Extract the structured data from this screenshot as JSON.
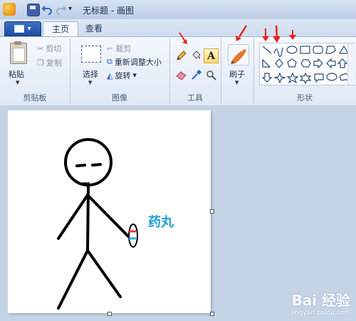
{
  "window": {
    "title": "无标题 - 画图"
  },
  "tabs": {
    "file_icon": "file-menu-icon",
    "home": "主页",
    "view": "查看"
  },
  "clipboard": {
    "paste": "粘贴",
    "cut": "剪切",
    "copy": "复制",
    "group_label": "剪贴板"
  },
  "image": {
    "select": "选择",
    "crop": "裁剪",
    "resize": "重新调整大小",
    "rotate": "旋转",
    "group_label": "图像"
  },
  "tools": {
    "group_label": "工具",
    "icons": [
      "pencil-icon",
      "fill-icon",
      "text-icon",
      "eraser-icon",
      "color-picker-icon",
      "magnifier-icon"
    ]
  },
  "brushes": {
    "label": "刷子"
  },
  "shapes": {
    "group_label": "形状"
  },
  "canvas": {
    "pill_label": "药丸"
  },
  "watermark": {
    "logo": "Bai 经验",
    "url": "jingyan.baidu.com"
  },
  "colors": {
    "annotation_arrow": "#e8211a",
    "accent": "#1a9fd8"
  }
}
